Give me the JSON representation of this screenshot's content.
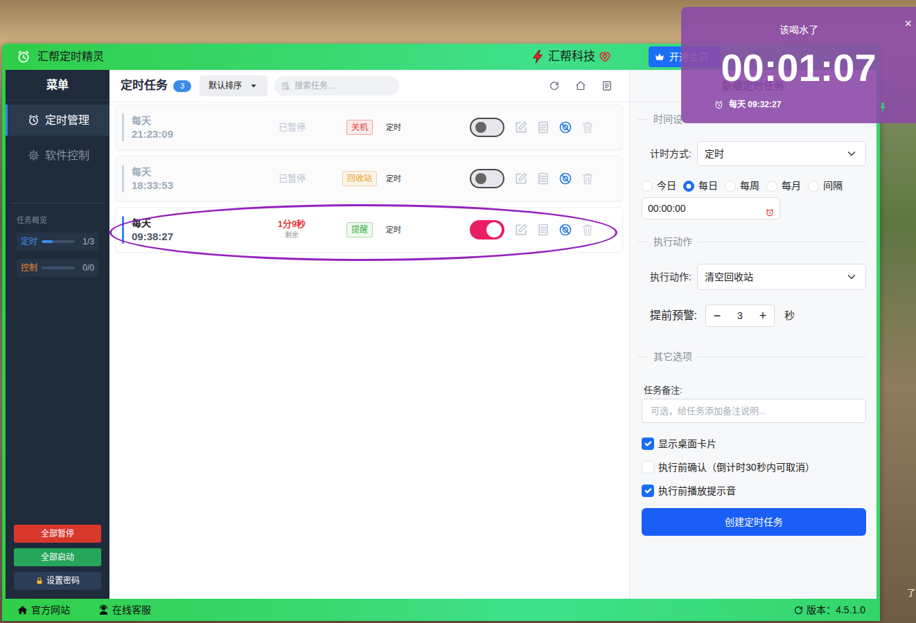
{
  "window": {
    "title": "汇帮定时精灵",
    "brand": "汇帮科技",
    "vip_button": "开通会员"
  },
  "sidebar": {
    "title": "菜单",
    "items": [
      {
        "label": "定时管理",
        "selected": true
      },
      {
        "label": "软件控制",
        "selected": false
      }
    ],
    "overview": {
      "title": "任务概览",
      "stats": [
        {
          "label": "定时",
          "count": "1/3",
          "level": 0.33,
          "color": "#3b8beb"
        },
        {
          "label": "控制",
          "count": "0/0",
          "level": 0,
          "color": "#e8862a"
        }
      ]
    },
    "buttons": [
      {
        "label": "全部暂停",
        "color": "#d8382c"
      },
      {
        "label": "全部启动",
        "color": "#26a65b"
      },
      {
        "label": "设置密码",
        "color": "#2b3d57"
      }
    ]
  },
  "tasks": {
    "title": "定时任务",
    "count": "3",
    "sort": "默认排序",
    "search": {
      "placeholder": "搜索任务..."
    },
    "rows": [
      {
        "repeat": "每天",
        "time": "21:23:09",
        "status": "已暂停",
        "tag": "关机",
        "color": "#e53935",
        "type": "定时",
        "on": false,
        "paused": true,
        "highlighted": false
      },
      {
        "repeat": "每天",
        "time": "18:33:53",
        "status": "已暂停",
        "tag": "回收站",
        "color": "#f0a020",
        "type": "定时",
        "on": false,
        "paused": true,
        "highlighted": false
      },
      {
        "repeat": "每天",
        "time": "09:38:27",
        "status": "1分9秒",
        "note": "剩余",
        "tag": "提醒",
        "color": "#3cb043",
        "type": "定时",
        "on": true,
        "paused": false,
        "highlighted": true
      }
    ]
  },
  "form": {
    "title": "新建定时任务",
    "time_section": "时间设",
    "mode_label": "计时方式:",
    "mode_value": "定时",
    "repeat_options": [
      {
        "label": "今日",
        "selected": false
      },
      {
        "label": "每日",
        "selected": true
      },
      {
        "label": "每周",
        "selected": false
      },
      {
        "label": "每月",
        "selected": false
      },
      {
        "label": "间隔",
        "selected": false
      }
    ],
    "time_value": "00:00:00",
    "action_section": "执行动作",
    "action_label": "执行动作:",
    "action_value": "清空回收站",
    "warn_label": "提前预警:",
    "warn_minus": "−",
    "warn_value": "3",
    "warn_plus": "+",
    "warn_unit": "秒",
    "other_section": "其它选项",
    "note_label": "任务备注:",
    "note_placeholder": "可选，给任务添加备注说明...",
    "options": [
      {
        "label": "显示桌面卡片",
        "checked": true
      },
      {
        "label": "执行前确认（倒计时30秒内可取消）",
        "checked": false
      },
      {
        "label": "执行前播放提示音",
        "checked": true
      }
    ],
    "submit": "创建定时任务"
  },
  "status_bar": {
    "links": [
      "官方网站",
      "在线客服"
    ],
    "version": "版本：4.5.1.0"
  },
  "reminder_card": {
    "title": "该喝水了",
    "countdown": "00:01:07",
    "schedule": "每天 09:32:27",
    "close": "×",
    "pinned": true
  },
  "desktop": {
    "fragment": "了"
  }
}
